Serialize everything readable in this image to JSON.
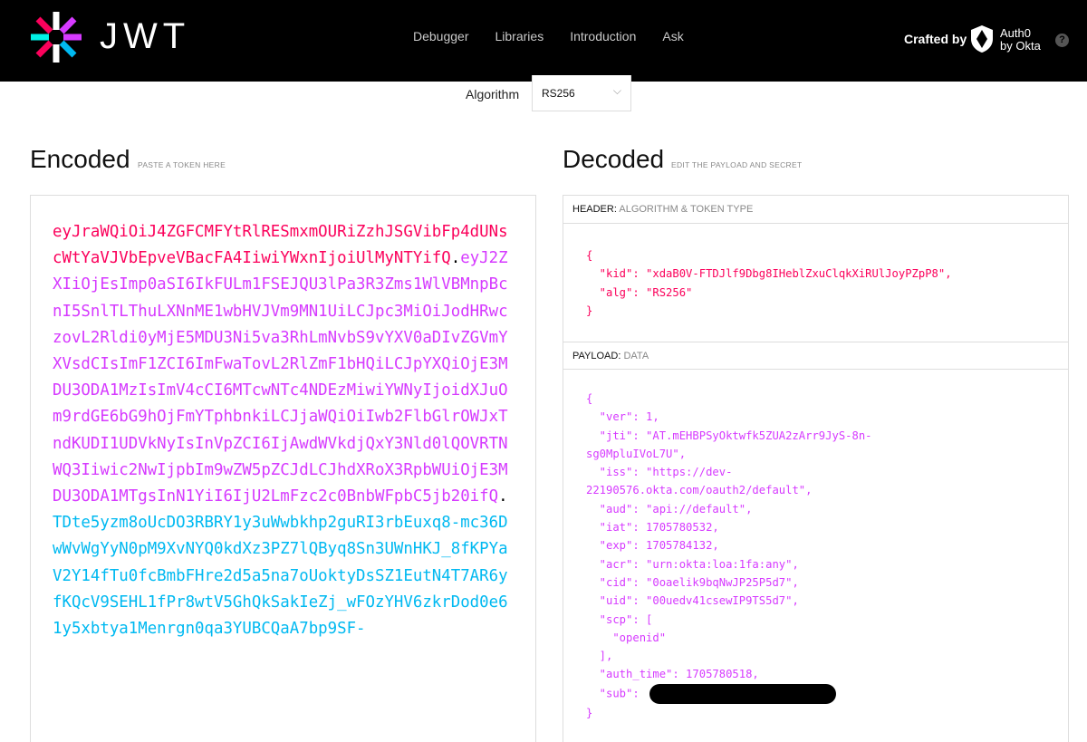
{
  "header": {
    "logo_text": "JWT",
    "nav": [
      "Debugger",
      "Libraries",
      "Introduction",
      "Ask"
    ],
    "crafted_by": "Crafted by",
    "auth0_line1": "Auth0",
    "auth0_line2": "by Okta",
    "help_icon": "?"
  },
  "algorithm": {
    "label": "Algorithm",
    "value": "RS256"
  },
  "encoded": {
    "title": "Encoded",
    "subtitle": "PASTE A TOKEN HERE",
    "header_part": "eyJraWQiOiJ4ZGFCMFYtRlRESmxmOURiZzhJSGVibFp4dUNscWtYaVJVbEpveVBacFA4IiwiYWxnIjoiUlMyNTYifQ",
    "payload_part": "eyJ2ZXIiOjEsImp0aSI6IkFULm1FSEJQU3lPa3R3Zms1WlVBMnpBcnI5SnlTLThuLXNnME1wbHVJVm9MN1UiLCJpc3MiOiJodHRwczovL2Rldi0yMjE5MDU3Ni5va3RhLmNvbS9vYXV0aDIvZGVmYXVsdCIsImF1ZCI6ImFwaTovL2RlZmF1bHQiLCJpYXQiOjE3MDU3ODA1MzIsImV4cCI6MTcwNTc4NDEzMiwiYWNyIjoidXJuOm9rdGE6bG9hOjFmYTphbnkiLCJjaWQiOiIwb2FlbGlrOWJxTndKUDI1UDVkNyIsInVpZCI6IjAwdWVkdjQxY3Nld0lQOVRTNWQ3Iiwic2NwIjpbIm9wZW5pZCJdLCJhdXRoX3RpbWUiOjE3MDU3ODA1MTgsInN1YiI6IjU2LmFzc2c0BnbWFpbC5jb20ifQ",
    "signature_part": "TDte5yzm8oUcDO3RBRY1y3uWwbkhp2guRI3rbEuxq8-mc36DwWvWgYyN0pM9XvNYQ0kdXz3PZ7lQByq8Sn3UWnHKJ_8fKPYaV2Y14fTu0fcBmbFHre2d5a5na7oUoktyDsSZ1EutN4T7AR6yfKQcV9SEHL1fPr8wtV5GhQkSakIeZj_wFOzYHV6zkrDod0e61y5xbtya1Menrgn0qa3YUBCQaA7bp9SF-"
  },
  "decoded": {
    "title": "Decoded",
    "subtitle": "EDIT THE PAYLOAD AND SECRET",
    "header_label": "HEADER:",
    "header_sub": "ALGORITHM & TOKEN TYPE",
    "header_json": "{\n  \"kid\": \"xdaB0V-FTDJlf9Dbg8IHeblZxuClqkXiRUlJoyPZpP8\",\n  \"alg\": \"RS256\"\n}",
    "payload_label": "PAYLOAD:",
    "payload_sub": "DATA",
    "payload_json": "{\n  \"ver\": 1,\n  \"jti\": \"AT.mEHBPSyOktwfk5ZUA2zArr9JyS-8n-\nsg0MpluIVoL7U\",\n  \"iss\": \"https://dev-\n22190576.okta.com/oauth2/default\",\n  \"aud\": \"api://default\",\n  \"iat\": 1705780532,\n  \"exp\": 1705784132,\n  \"acr\": \"urn:okta:loa:1fa:any\",\n  \"cid\": \"0oaelik9bqNwJP25P5d7\",\n  \"uid\": \"00uedv41csewIP9TS5d7\",\n  \"scp\": [\n    \"openid\"\n  ],\n  \"auth_time\": 1705780518,\n  \"sub\": ",
    "payload_close": "}"
  }
}
